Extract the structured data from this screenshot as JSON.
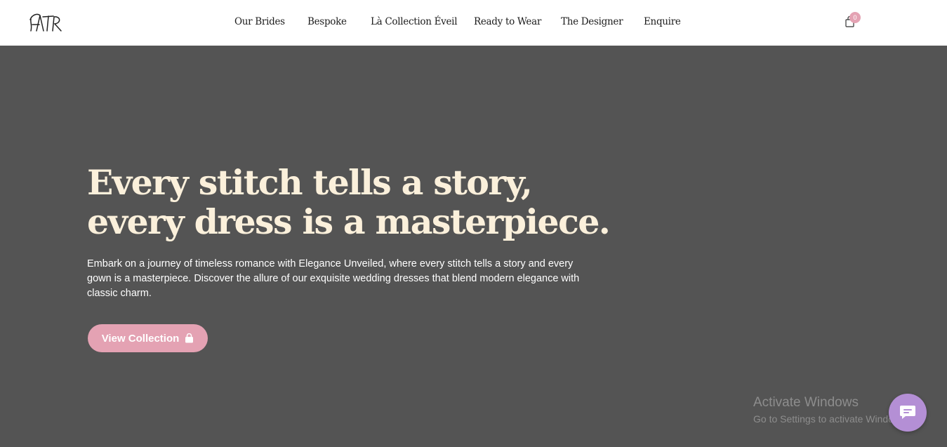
{
  "header": {
    "logo_text": "ATR",
    "nav": [
      {
        "label": "Our Brides"
      },
      {
        "label": "Bespoke"
      },
      {
        "label": "Là Collection Éveil"
      },
      {
        "label": "Ready to Wear"
      },
      {
        "label": "The Designer"
      },
      {
        "label": "Enquire"
      }
    ],
    "cart": {
      "count": "0",
      "icon": "shopping-bag-icon"
    }
  },
  "hero": {
    "headline_line1": "Every stitch tells a story,",
    "headline_line2": "every dress is a masterpiece.",
    "intro": "Embark on a journey of timeless romance with Elegance Unveiled, where every stitch tells a story and every gown is a masterpiece. Discover the allure of our exquisite wedding dresses that blend modern elegance with classic charm.",
    "cta_label": "View Collection",
    "cta_icon": "shopping-bag-icon"
  },
  "watermark": {
    "title": "Activate Windows",
    "subtitle": "Go to Settings to activate Windows."
  },
  "chat": {
    "icon": "chat-icon"
  },
  "colors": {
    "header_bg": "#ffffff",
    "hero_bg": "#545454",
    "headline": "#fbf0db",
    "accent_pink": "#e4a2b3",
    "chat_purple": "#b48fd5"
  }
}
